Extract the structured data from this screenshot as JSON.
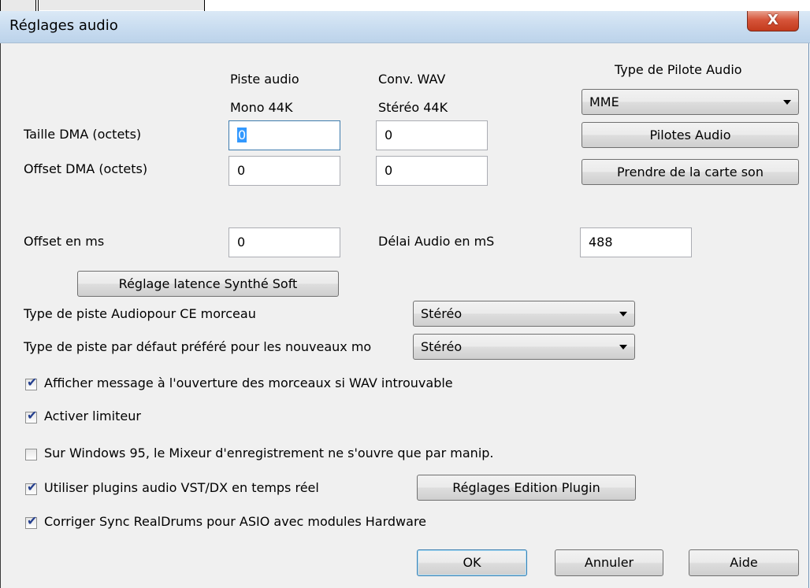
{
  "window": {
    "title": "Réglages audio",
    "close_glyph": "X"
  },
  "columns": {
    "col1_header_line1": "Piste audio",
    "col1_header_line2": "Mono 44K",
    "col2_header_line1": "Conv. WAV",
    "col2_header_line2": "Stéréo 44K",
    "driver_type_label": "Type de Pilote Audio"
  },
  "dma_size": {
    "label": "Taille DMA (octets)",
    "mono_value": "0",
    "wav_value": "0"
  },
  "dma_offset": {
    "label": "Offset DMA (octets)",
    "mono_value": "0",
    "wav_value": "0"
  },
  "driver": {
    "selected": "MME",
    "drivers_button": "Pilotes Audio",
    "from_card_button": "Prendre de la carte son"
  },
  "offset_ms": {
    "label": "Offset en ms",
    "value": "0"
  },
  "audio_delay": {
    "label": "Délai Audio en mS",
    "value": "488"
  },
  "latency_button": "Réglage latence Synthé Soft",
  "track_type_song": {
    "label": "Type de piste Audiopour CE morceau",
    "selected": "Stéréo"
  },
  "track_type_default": {
    "label": "Type de piste par défaut préféré pour les nouveaux mo",
    "selected": "Stéréo"
  },
  "options": [
    {
      "label": "Afficher message à l'ouverture des morceaux si WAV introuvable",
      "checked": true
    },
    {
      "label": "Activer limiteur",
      "checked": true
    },
    {
      "label": "Sur Windows 95, le Mixeur d'enregistrement ne s'ouvre que par manip.",
      "checked": false
    },
    {
      "label": "Utiliser plugins audio VST/DX en temps réel",
      "checked": true
    },
    {
      "label": "Corriger Sync RealDrums pour ASIO avec modules Hardware",
      "checked": true
    }
  ],
  "plugin_settings_button": "Réglages Edition Plugin",
  "footer": {
    "ok": "OK",
    "cancel": "Annuler",
    "help": "Aide"
  }
}
